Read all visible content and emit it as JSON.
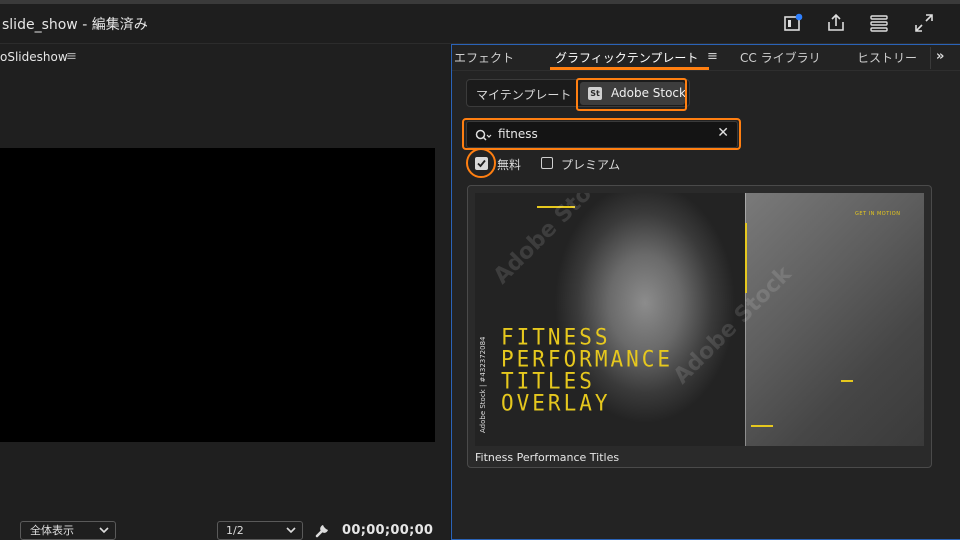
{
  "titlebar": {
    "title": "slide_show - 編集済み"
  },
  "program_monitor": {
    "tab_label": "oSlideshow",
    "menu_glyph": "≡",
    "fit_value": "全体表示",
    "resolution_value": "1/2",
    "timecode": "00;00;00;00"
  },
  "graphics_panel": {
    "tabs": [
      "エフェクト",
      "グラフィックテンプレート",
      "CC ライブラリ",
      "ヒストリー"
    ],
    "menu_glyph": "≡",
    "more_glyph": "»",
    "segments": {
      "my_templates": "マイテンプレート",
      "adobe_stock_badge": "St",
      "adobe_stock": "Adobe Stock"
    },
    "search": {
      "value": "fitness",
      "clear_glyph": "✕"
    },
    "filters": {
      "free_label": "無料",
      "free_checked": true,
      "premium_label": "プレミアム",
      "premium_checked": false
    },
    "result": {
      "caption": "Fitness Performance Titles",
      "thumb_title_lines": [
        "FITNESS",
        "PERFORMANCE",
        "TITLES",
        "OVERLAY"
      ],
      "thumb_side_text": "Adobe Stock | #432372084",
      "thumb_small_text": "GET IN MOTION",
      "watermark_text": "Adobe Stock"
    }
  },
  "colors": {
    "highlight": "#ff7f11",
    "panel_focus": "#2a63b8",
    "thumb_accent": "#e6c81e"
  }
}
